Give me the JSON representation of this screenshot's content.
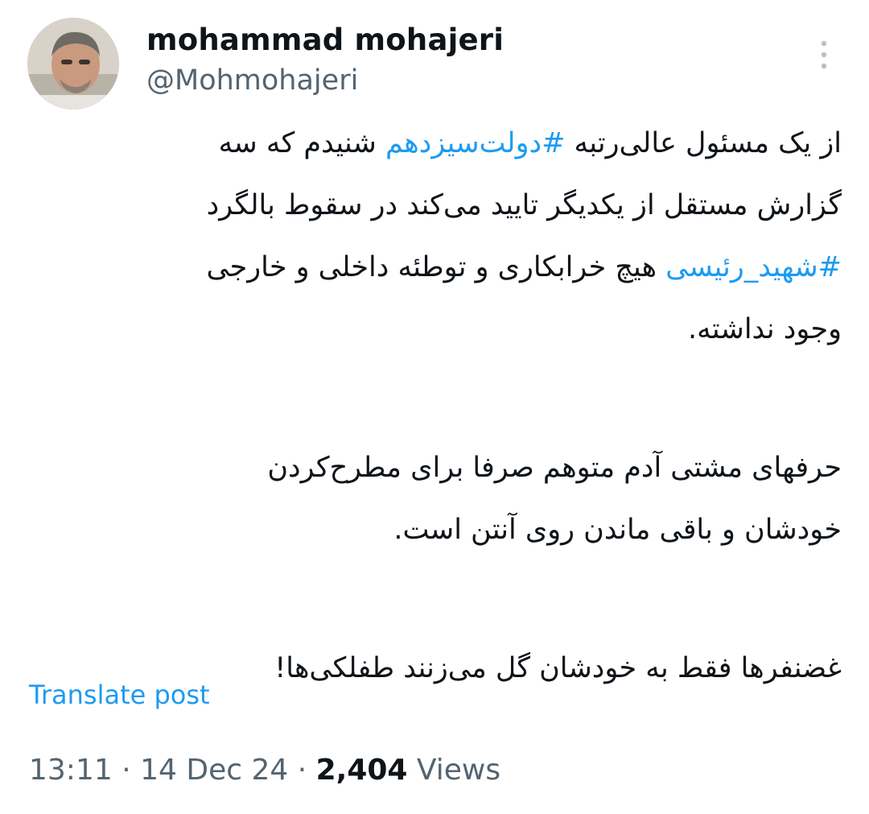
{
  "author": {
    "display_name": "mohammad mohajeri",
    "handle": "@Mohmohajeri",
    "avatar_icon": "profile-photo-avatar"
  },
  "menu_icon": "more-vertical-icon",
  "tweet": {
    "p1": {
      "l1_a": "از یک مسئول عالی‌رتبه ",
      "l1_tag": "#دولت‌سیزدهم",
      "l1_b": " شنیدم که سه",
      "l2": "گزارش مستقل از یکدیگر تایید می‌کند در سقوط بالگرد",
      "l3_tag": "#شهید_رئیسی",
      "l3_b": " هیچ خرابکاری و توطئه داخلی و خارجی",
      "l4": "وجود نداشته."
    },
    "p2": {
      "l1": "حرفهای مشتی آدم متوهم صرفا برای مطرح‌کردن",
      "l2": "خودشان  و باقی ماندن روی آنتن است."
    },
    "p3": {
      "l1": "غضنفرها فقط به خودشان گل می‌زنند طفلکی‌ها!"
    }
  },
  "translate_label": "Translate post",
  "meta": {
    "time": "13:11",
    "sep1": " · ",
    "date": "14 Dec 24",
    "sep2": " · ",
    "views_count": "2,404",
    "views_label": " Views"
  },
  "colors": {
    "link": "#1d9bf0",
    "secondary_text": "#536471",
    "primary_text": "#0f1419"
  }
}
